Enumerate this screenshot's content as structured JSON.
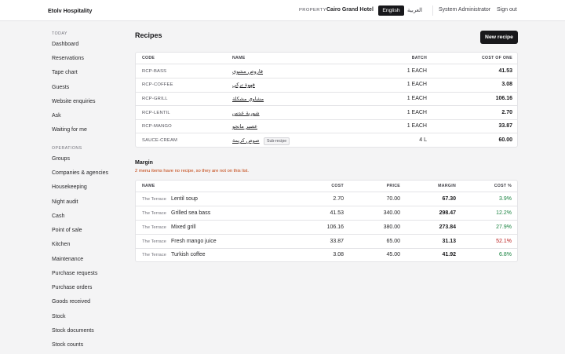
{
  "header": {
    "brand": "Etolv Hospitality",
    "property_label": "PROPERTY",
    "property_name": "Cairo Grand Hotel",
    "lang_active": "English",
    "lang_other": "العربية",
    "user": "System Administrator",
    "sign_out": "Sign out"
  },
  "sidebar": {
    "section_today": "TODAY",
    "section_operations": "OPERATIONS",
    "today_items": [
      "Dashboard",
      "Reservations",
      "Tape chart",
      "Guests",
      "Website enquiries",
      "Ask",
      "Waiting for me"
    ],
    "ops_items": [
      "Groups",
      "Companies & agencies",
      "Housekeeping",
      "Night audit",
      "Cash",
      "Point of sale",
      "Kitchen",
      "Maintenance",
      "Purchase requests",
      "Purchase orders",
      "Goods received",
      "Stock",
      "Stock documents",
      "Stock counts"
    ]
  },
  "recipes": {
    "title": "Recipes",
    "new_button": "New recipe",
    "columns": {
      "code": "CODE",
      "name": "NAME",
      "batch": "BATCH",
      "cost": "COST OF ONE"
    },
    "sub_recipe_label": "Sub-recipe",
    "rows": [
      {
        "code": "RCP-BASS",
        "name": "قاروص مشوي",
        "batch": "1 EACH",
        "cost": "41.53",
        "sub": false
      },
      {
        "code": "RCP-COFFEE",
        "name": "قهوة تركي",
        "batch": "1 EACH",
        "cost": "3.08",
        "sub": false
      },
      {
        "code": "RCP-GRILL",
        "name": "مشاوي مشكلة",
        "batch": "1 EACH",
        "cost": "106.16",
        "sub": false
      },
      {
        "code": "RCP-LENTIL",
        "name": "شوربة عدس",
        "batch": "1 EACH",
        "cost": "2.70",
        "sub": false
      },
      {
        "code": "RCP-MANGO",
        "name": "عصير مانجو",
        "batch": "1 EACH",
        "cost": "33.87",
        "sub": false
      },
      {
        "code": "SAUCE-CREAM",
        "name": "صوص كريمة",
        "batch": "4 L",
        "cost": "60.00",
        "sub": true
      }
    ]
  },
  "margin": {
    "title": "Margin",
    "note": "2 menu items have no recipe, so they are not on this list.",
    "columns": {
      "name": "NAME",
      "cost": "COST",
      "price": "PRICE",
      "margin": "MARGIN",
      "pct": "COST %"
    },
    "rows": [
      {
        "venue": "The Terrace",
        "name": "Lentil soup",
        "cost": "2.70",
        "price": "70.00",
        "margin": "67.30",
        "pct": "3.9%",
        "tone": "green"
      },
      {
        "venue": "The Terrace",
        "name": "Grilled sea bass",
        "cost": "41.53",
        "price": "340.00",
        "margin": "298.47",
        "pct": "12.2%",
        "tone": "green"
      },
      {
        "venue": "The Terrace",
        "name": "Mixed grill",
        "cost": "106.16",
        "price": "380.00",
        "margin": "273.84",
        "pct": "27.9%",
        "tone": "green"
      },
      {
        "venue": "The Terrace",
        "name": "Fresh mango juice",
        "cost": "33.87",
        "price": "65.00",
        "margin": "31.13",
        "pct": "52.1%",
        "tone": "red"
      },
      {
        "venue": "The Terrace",
        "name": "Turkish coffee",
        "cost": "3.08",
        "price": "45.00",
        "margin": "41.92",
        "pct": "6.8%",
        "tone": "green"
      }
    ]
  },
  "colors": {
    "positive": "#15803d",
    "negative": "#b91c1c",
    "note": "#c2410c",
    "primary": "#18181b"
  }
}
